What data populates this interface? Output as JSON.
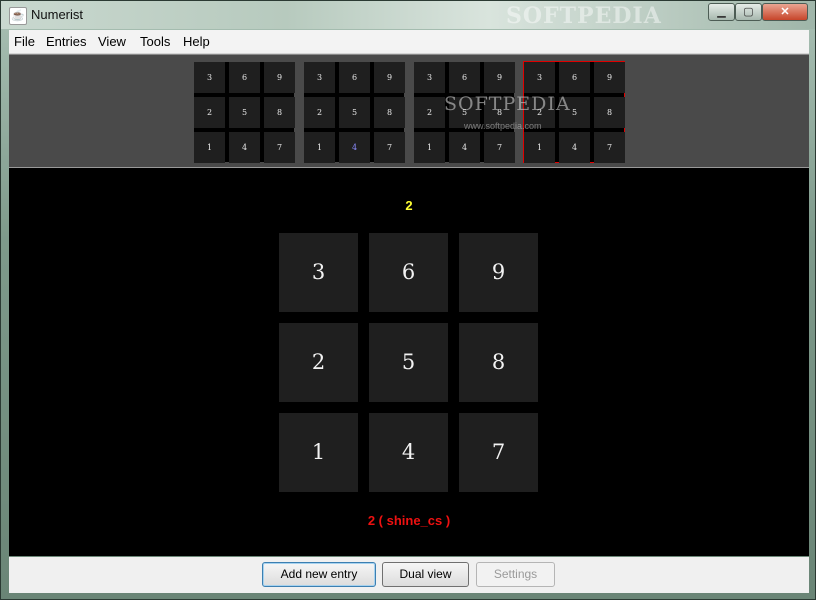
{
  "window": {
    "title": "Numerist",
    "icon": "java-cup-icon",
    "watermark": "SOFTPEDIA",
    "controls": [
      "minimize-icon",
      "maximize-icon",
      "close-icon"
    ]
  },
  "menu": {
    "items": [
      "File",
      "Entries",
      "View",
      "Tools",
      "Help"
    ]
  },
  "thumbnails": [
    {
      "rows": [
        [
          "3",
          "6",
          "9"
        ],
        [
          "2",
          "5",
          "8"
        ],
        [
          "1",
          "4",
          "7"
        ]
      ],
      "selected": false
    },
    {
      "rows": [
        [
          "3",
          "6",
          "9"
        ],
        [
          "2",
          "5",
          "8"
        ],
        [
          "1",
          "4",
          "7"
        ]
      ],
      "selected": false,
      "highlighted_value": "4"
    },
    {
      "rows": [
        [
          "3",
          "6",
          "9"
        ],
        [
          "2",
          "5",
          "8"
        ],
        [
          "1",
          "4",
          "7"
        ]
      ],
      "selected": false
    },
    {
      "rows": [
        [
          "3",
          "6",
          "9"
        ],
        [
          "2",
          "5",
          "8"
        ],
        [
          "1",
          "4",
          "7"
        ]
      ],
      "selected": true
    }
  ],
  "strip_watermark": {
    "text": "SOFTPEDIA",
    "url": "www.softpedia.com"
  },
  "display": {
    "current": "2",
    "keypad": [
      [
        "3",
        "6",
        "9"
      ],
      [
        "2",
        "5",
        "8"
      ],
      [
        "1",
        "4",
        "7"
      ]
    ],
    "entry_label": "2 ( shine_cs )"
  },
  "buttons": {
    "add": "Add new entry",
    "dual": "Dual view",
    "settings": "Settings"
  },
  "colors": {
    "current_label": "#ffff33",
    "entry_label": "#ee1111",
    "selected_border": "#e00000"
  }
}
